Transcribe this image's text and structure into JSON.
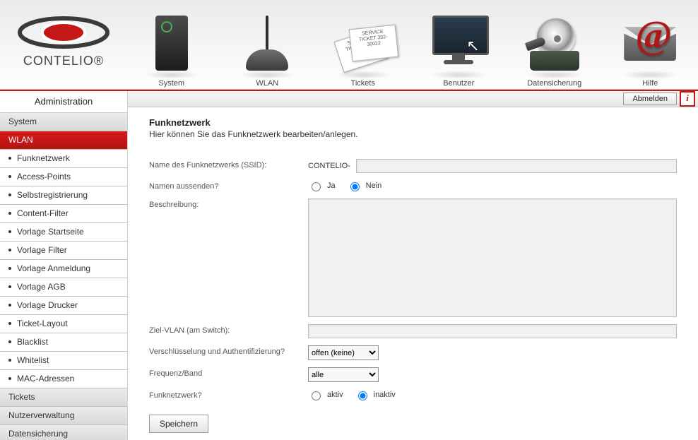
{
  "brand": {
    "name": "CONTELIO®"
  },
  "topnav": {
    "items": [
      {
        "label": "System"
      },
      {
        "label": "WLAN"
      },
      {
        "label": "Tickets"
      },
      {
        "label": "Benutzer"
      },
      {
        "label": "Datensicherung"
      },
      {
        "label": "Hilfe"
      }
    ],
    "ticket_text": "SERVICE TICKET\n302-30022"
  },
  "toolbar": {
    "logout_label": "Abmelden",
    "info_glyph": "i"
  },
  "sidebar": {
    "title": "Administration",
    "groups": [
      {
        "label": "System",
        "active": false
      },
      {
        "label": "WLAN",
        "active": true
      },
      {
        "label": "Tickets",
        "active": false
      },
      {
        "label": "Nutzerverwaltung",
        "active": false
      },
      {
        "label": "Datensicherung",
        "active": false
      }
    ],
    "wlan_sub": [
      "Funknetzwerk",
      "Access-Points",
      "Selbstregistrierung",
      "Content-Filter",
      "Vorlage Startseite",
      "Vorlage Filter",
      "Vorlage Anmeldung",
      "Vorlage AGB",
      "Vorlage Drucker",
      "Ticket-Layout",
      "Blacklist",
      "Whitelist",
      "MAC-Adressen"
    ]
  },
  "page": {
    "title": "Funknetzwerk",
    "subtitle": "Hier können Sie das Funknetzwerk bearbeiten/anlegen."
  },
  "form": {
    "ssid_label": "Name des Funknetzwerks (SSID):",
    "ssid_prefix": "CONTELIO-",
    "ssid_value": "",
    "broadcast_label": "Namen aussenden?",
    "broadcast_yes": "Ja",
    "broadcast_no": "Nein",
    "broadcast_selected": "Nein",
    "description_label": "Beschreibung:",
    "description_value": "",
    "vlan_label": "Ziel-VLAN (am Switch):",
    "vlan_value": "",
    "encryption_label": "Verschlüsselung und Authentifizierung?",
    "encryption_value": "offen (keine)",
    "band_label": "Frequenz/Band",
    "band_value": "alle",
    "state_label": "Funknetzwerk?",
    "state_active": "aktiv",
    "state_inactive": "inaktiv",
    "state_selected": "inaktiv",
    "save_label": "Speichern"
  }
}
